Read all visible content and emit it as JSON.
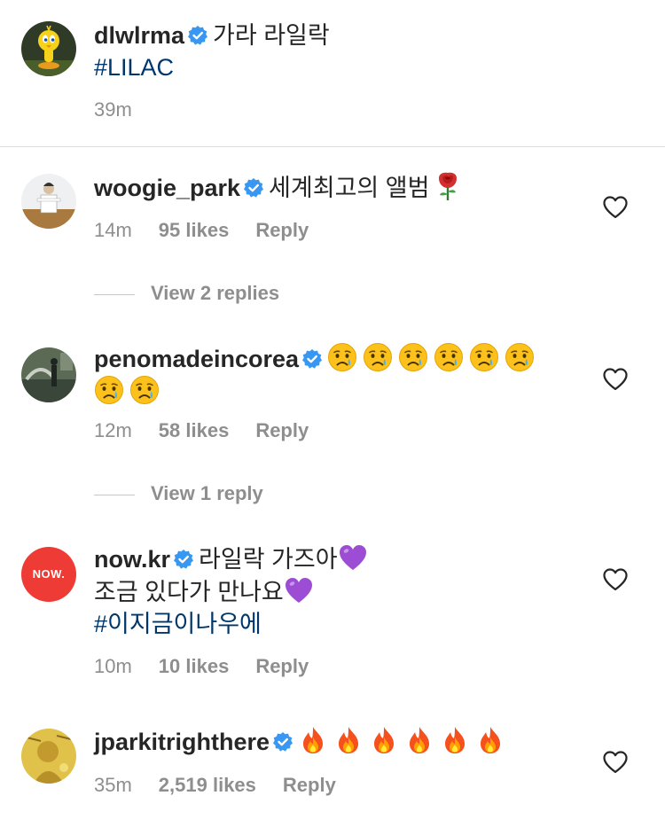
{
  "caption": {
    "username": "dlwlrma",
    "text": "가라 라일락",
    "hashtag": "#LILAC",
    "time": "39m"
  },
  "comments": [
    {
      "username": "woogie_park",
      "text": "세계최고의 앨범",
      "emoji": [
        "rose"
      ],
      "time": "14m",
      "likes": "95 likes",
      "reply": "Reply",
      "view_replies": "View 2 replies"
    },
    {
      "username": "penomadeincorea",
      "emoji": [
        "crying-face",
        "crying-face",
        "crying-face",
        "crying-face",
        "crying-face",
        "crying-face",
        "crying-face",
        "crying-face"
      ],
      "time": "12m",
      "likes": "58 likes",
      "reply": "Reply",
      "view_replies": "View 1 reply"
    },
    {
      "username": "now.kr",
      "avatar_text": "NOW.",
      "text_line1": "라일락 가즈아",
      "text_line2": "조금 있다가 만나요",
      "hashtag": "#이지금이나우에",
      "emoji": [
        "purple-heart"
      ],
      "time": "10m",
      "likes": "10 likes",
      "reply": "Reply"
    },
    {
      "username": "jparkitrighthere",
      "emoji": [
        "fire",
        "fire",
        "fire",
        "fire",
        "fire",
        "fire"
      ],
      "time": "35m",
      "likes": "2,519 likes",
      "reply": "Reply"
    }
  ],
  "colors": {
    "verified": "#3897f0",
    "hashtag": "#00376b",
    "muted": "#8e8e8e",
    "now_avatar": "#ef3b36"
  }
}
